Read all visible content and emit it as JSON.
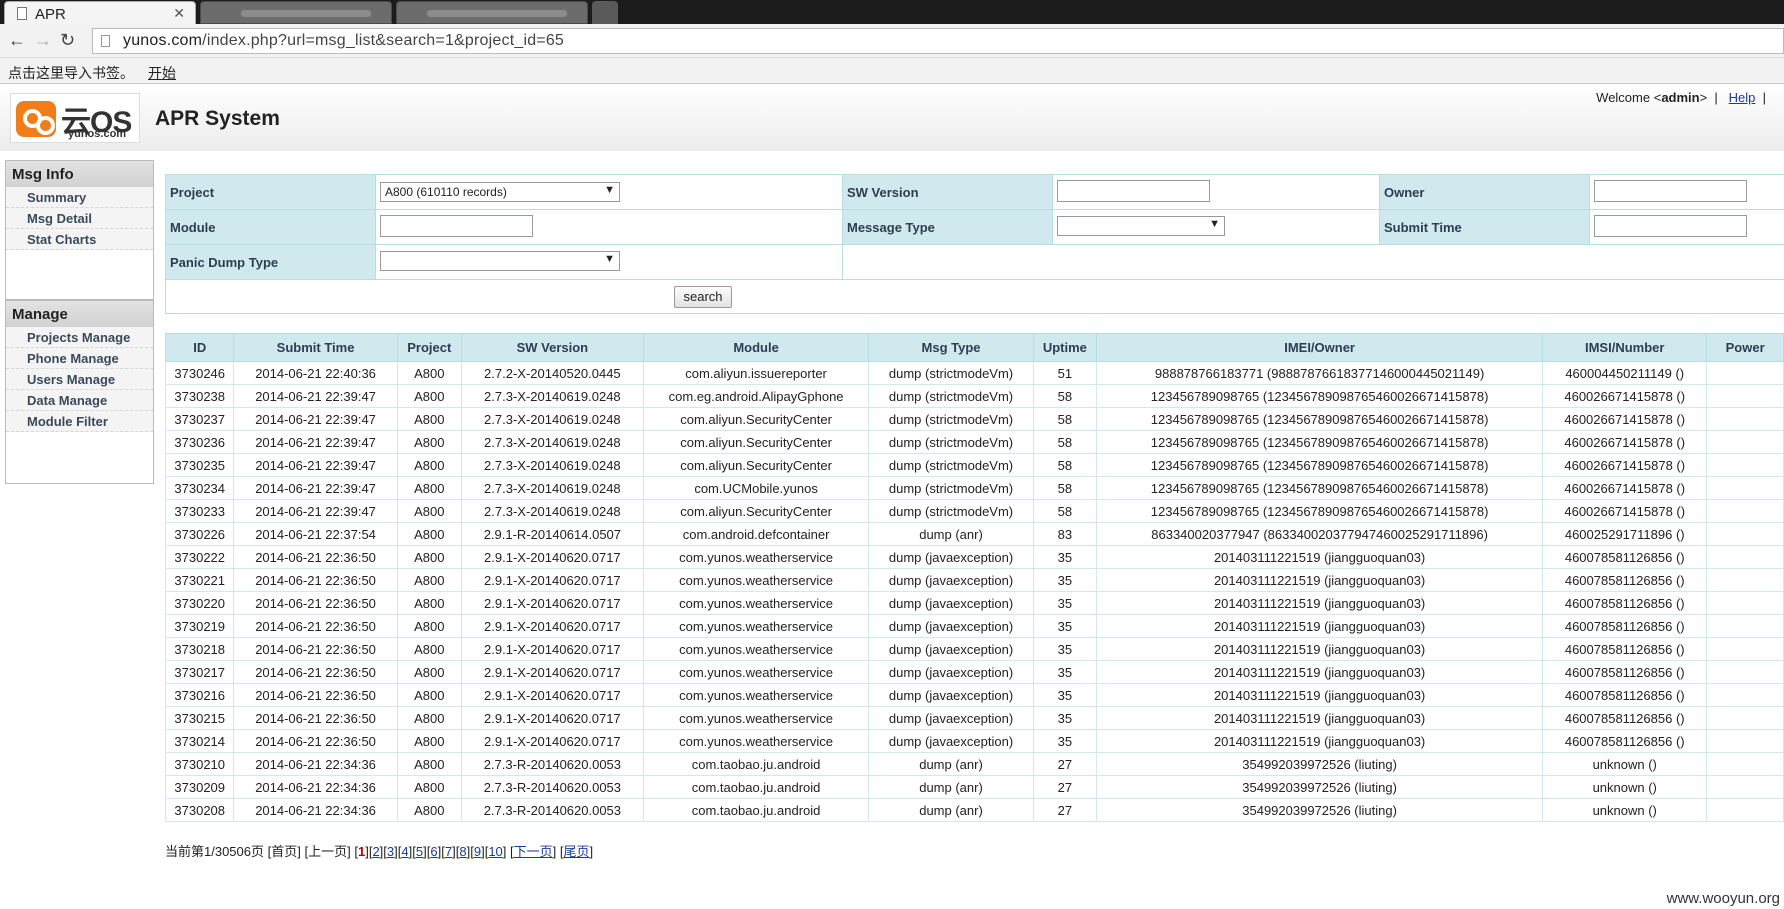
{
  "browser": {
    "active_tab_title": "APR",
    "url_host": "yunos.com",
    "url_path": "/index.php?url=msg_list&search=1&project_id=65",
    "bookmark_hint": "点击这里导入书签。",
    "bookmark_start": "开始"
  },
  "header": {
    "logo_text": "云OS",
    "logo_domain": "yunos.com",
    "system_title": "APR System",
    "welcome_prefix": "Welcome <",
    "user": "admin",
    "welcome_suffix": ">",
    "help": "Help"
  },
  "sidebar": {
    "msg_title": "Msg Info",
    "msg_items": [
      "Summary",
      "Msg Detail",
      "Stat Charts"
    ],
    "manage_title": "Manage",
    "manage_items": [
      "Projects Manage",
      "Phone Manage",
      "Users Manage",
      "Data Manage",
      "Module Filter"
    ]
  },
  "search": {
    "project_label": "Project",
    "project_value": "A800 (610110 records)",
    "sw_label": "SW Version",
    "owner_label": "Owner",
    "module_label": "Module",
    "msgtype_label": "Message Type",
    "submit_label": "Submit Time",
    "panic_label": "Panic Dump Type",
    "button": "search"
  },
  "table": {
    "headers": [
      "ID",
      "Submit Time",
      "Project",
      "SW Version",
      "Module",
      "Msg Type",
      "Uptime",
      "IMEI/Owner",
      "IMSI/Number",
      "Power"
    ],
    "rows": [
      [
        "3730246",
        "2014-06-21 22:40:36",
        "A800",
        "2.7.2-X-20140520.0445",
        "com.aliyun.issuereporter",
        "dump (strictmodeVm)",
        "51",
        "988878766183771 (98887876618377146000445021149)",
        "460004450211149 ()",
        ""
      ],
      [
        "3730238",
        "2014-06-21 22:39:47",
        "A800",
        "2.7.3-X-20140619.0248",
        "com.eg.android.AlipayGphone",
        "dump (strictmodeVm)",
        "58",
        "123456789098765 (12345678909876546002667141587­8)",
        "460026671415878 ()",
        ""
      ],
      [
        "3730237",
        "2014-06-21 22:39:47",
        "A800",
        "2.7.3-X-20140619.0248",
        "com.aliyun.SecurityCenter",
        "dump (strictmodeVm)",
        "58",
        "123456789098765 (123456789098765460026671415878)",
        "460026671415878 ()",
        ""
      ],
      [
        "3730236",
        "2014-06-21 22:39:47",
        "A800",
        "2.7.3-X-20140619.0248",
        "com.aliyun.SecurityCenter",
        "dump (strictmodeVm)",
        "58",
        "123456789098765 (123456789098765460026671415878)",
        "460026671415878 ()",
        ""
      ],
      [
        "3730235",
        "2014-06-21 22:39:47",
        "A800",
        "2.7.3-X-20140619.0248",
        "com.aliyun.SecurityCenter",
        "dump (strictmodeVm)",
        "58",
        "123456789098765 (123456789098765460026671415878)",
        "460026671415878 ()",
        ""
      ],
      [
        "3730234",
        "2014-06-21 22:39:47",
        "A800",
        "2.7.3-X-20140619.0248",
        "com.UCMobile.yunos",
        "dump (strictmodeVm)",
        "58",
        "123456789098765 (123456789098765460026671415878)",
        "460026671415878 ()",
        ""
      ],
      [
        "3730233",
        "2014-06-21 22:39:47",
        "A800",
        "2.7.3-X-20140619.0248",
        "com.aliyun.SecurityCenter",
        "dump (strictmodeVm)",
        "58",
        "123456789098765 (123456789098765460026671415878)",
        "460026671415878 ()",
        ""
      ],
      [
        "3730226",
        "2014-06-21 22:37:54",
        "A800",
        "2.9.1-R-20140614.0507",
        "com.android.defcontainer",
        "dump (anr)",
        "83",
        "863340020377947 (863340020377947460025291711896)",
        "460025291711896 ()",
        ""
      ],
      [
        "3730222",
        "2014-06-21 22:36:50",
        "A800",
        "2.9.1-X-20140620.0717",
        "com.yunos.weatherservice",
        "dump (javaexception)",
        "35",
        "201403111221519 (jiangguoquan03)",
        "460078581126856 ()",
        ""
      ],
      [
        "3730221",
        "2014-06-21 22:36:50",
        "A800",
        "2.9.1-X-20140620.0717",
        "com.yunos.weatherservice",
        "dump (javaexception)",
        "35",
        "201403111221519 (jiangguoquan03)",
        "460078581126856 ()",
        ""
      ],
      [
        "3730220",
        "2014-06-21 22:36:50",
        "A800",
        "2.9.1-X-20140620.0717",
        "com.yunos.weatherservice",
        "dump (javaexception)",
        "35",
        "201403111221519 (jiangguoquan03)",
        "460078581126856 ()",
        ""
      ],
      [
        "3730219",
        "2014-06-21 22:36:50",
        "A800",
        "2.9.1-X-20140620.0717",
        "com.yunos.weatherservice",
        "dump (javaexception)",
        "35",
        "201403111221519 (jiangguoquan03)",
        "460078581126856 ()",
        ""
      ],
      [
        "3730218",
        "2014-06-21 22:36:50",
        "A800",
        "2.9.1-X-20140620.0717",
        "com.yunos.weatherservice",
        "dump (javaexception)",
        "35",
        "201403111221519 (jiangguoquan03)",
        "460078581126856 ()",
        ""
      ],
      [
        "3730217",
        "2014-06-21 22:36:50",
        "A800",
        "2.9.1-X-20140620.0717",
        "com.yunos.weatherservice",
        "dump (javaexception)",
        "35",
        "201403111221519 (jiangguoquan03)",
        "460078581126856 ()",
        ""
      ],
      [
        "3730216",
        "2014-06-21 22:36:50",
        "A800",
        "2.9.1-X-20140620.0717",
        "com.yunos.weatherservice",
        "dump (javaexception)",
        "35",
        "201403111221519 (jiangguoquan03)",
        "460078581126856 ()",
        ""
      ],
      [
        "3730215",
        "2014-06-21 22:36:50",
        "A800",
        "2.9.1-X-20140620.0717",
        "com.yunos.weatherservice",
        "dump (javaexception)",
        "35",
        "201403111221519 (jiangguoquan03)",
        "460078581126856 ()",
        ""
      ],
      [
        "3730214",
        "2014-06-21 22:36:50",
        "A800",
        "2.9.1-X-20140620.0717",
        "com.yunos.weatherservice",
        "dump (javaexception)",
        "35",
        "201403111221519 (jiangguoquan03)",
        "460078581126856 ()",
        ""
      ],
      [
        "3730210",
        "2014-06-21 22:34:36",
        "A800",
        "2.7.3-R-20140620.0053",
        "com.taobao.ju.android",
        "dump (anr)",
        "27",
        "354992039972526 (liuting)",
        "unknown ()",
        ""
      ],
      [
        "3730209",
        "2014-06-21 22:34:36",
        "A800",
        "2.7.3-R-20140620.0053",
        "com.taobao.ju.android",
        "dump (anr)",
        "27",
        "354992039972526 (liuting)",
        "unknown ()",
        ""
      ],
      [
        "3730208",
        "2014-06-21 22:34:36",
        "A800",
        "2.7.3-R-20140620.0053",
        "com.taobao.ju.android",
        "dump (anr)",
        "27",
        "354992039972526 (liuting)",
        "unknown ()",
        ""
      ]
    ]
  },
  "pager": {
    "status": "当前第1/30506页",
    "first": "[首页]",
    "prev": "[上一页]",
    "current": "1",
    "pages": [
      "2",
      "3",
      "4",
      "5",
      "6",
      "7",
      "8",
      "9",
      "10"
    ],
    "next": "下一页",
    "last": "尾页"
  },
  "watermark": "www.wooyun.org"
}
